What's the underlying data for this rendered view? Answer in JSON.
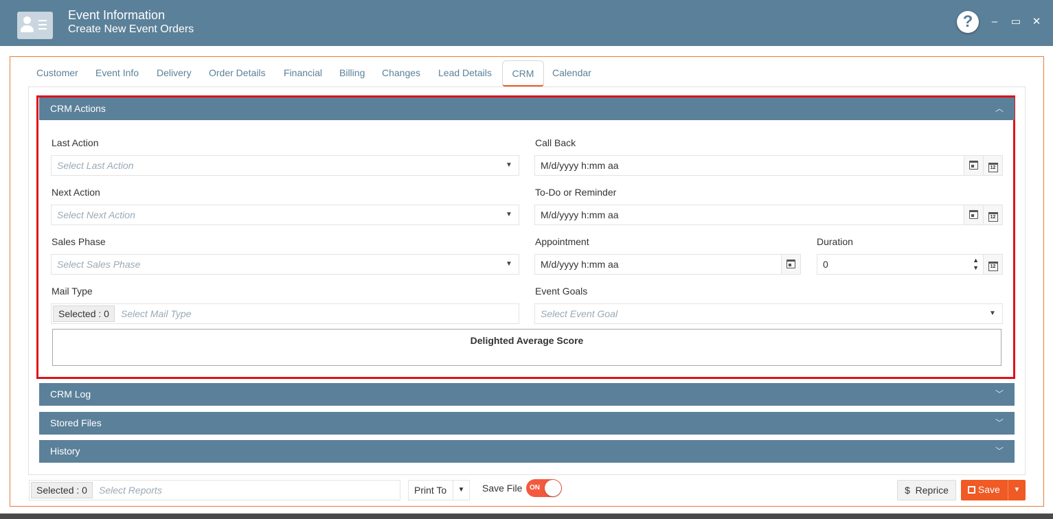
{
  "header": {
    "title": "Event Information",
    "subtitle": "Create New Event Orders",
    "help_label": "?",
    "minimize_label": "–",
    "maximize_label": "▭",
    "close_label": "✕"
  },
  "tabs": [
    {
      "label": "Customer"
    },
    {
      "label": "Event Info"
    },
    {
      "label": "Delivery"
    },
    {
      "label": "Order Details"
    },
    {
      "label": "Financial"
    },
    {
      "label": "Billing"
    },
    {
      "label": "Changes"
    },
    {
      "label": "Lead Details"
    },
    {
      "label": "CRM"
    },
    {
      "label": "Calendar"
    }
  ],
  "crm_actions": {
    "title": "CRM Actions",
    "last_action": {
      "label": "Last Action",
      "placeholder": "Select Last Action"
    },
    "next_action": {
      "label": "Next Action",
      "placeholder": "Select Next Action"
    },
    "sales_phase": {
      "label": "Sales Phase",
      "placeholder": "Select Sales Phase"
    },
    "mail_type": {
      "label": "Mail Type",
      "selected": "Selected : 0",
      "placeholder": "Select Mail Type"
    },
    "call_back": {
      "label": "Call Back",
      "value": "M/d/yyyy h:mm aa"
    },
    "todo": {
      "label": "To-Do or Reminder",
      "value": "M/d/yyyy h:mm aa"
    },
    "appointment": {
      "label": "Appointment",
      "value": "M/d/yyyy h:mm aa"
    },
    "duration": {
      "label": "Duration",
      "value": "0"
    },
    "event_goals": {
      "label": "Event Goals",
      "placeholder": "Select Event Goal"
    },
    "delighted_title": "Delighted Average Score"
  },
  "sections": {
    "crm_log": "CRM Log",
    "stored_files": "Stored Files",
    "history": "History"
  },
  "footer": {
    "reports_selected": "Selected : 0",
    "reports_placeholder": "Select Reports",
    "print_to": "Print To",
    "save_file_label": "Save File",
    "toggle_on": "ON",
    "reprice_label": "Reprice",
    "save_label": "Save"
  },
  "colors": {
    "header_bg": "#5b8099",
    "accent_orange": "#f05a24",
    "highlight_red": "#e0101a"
  }
}
